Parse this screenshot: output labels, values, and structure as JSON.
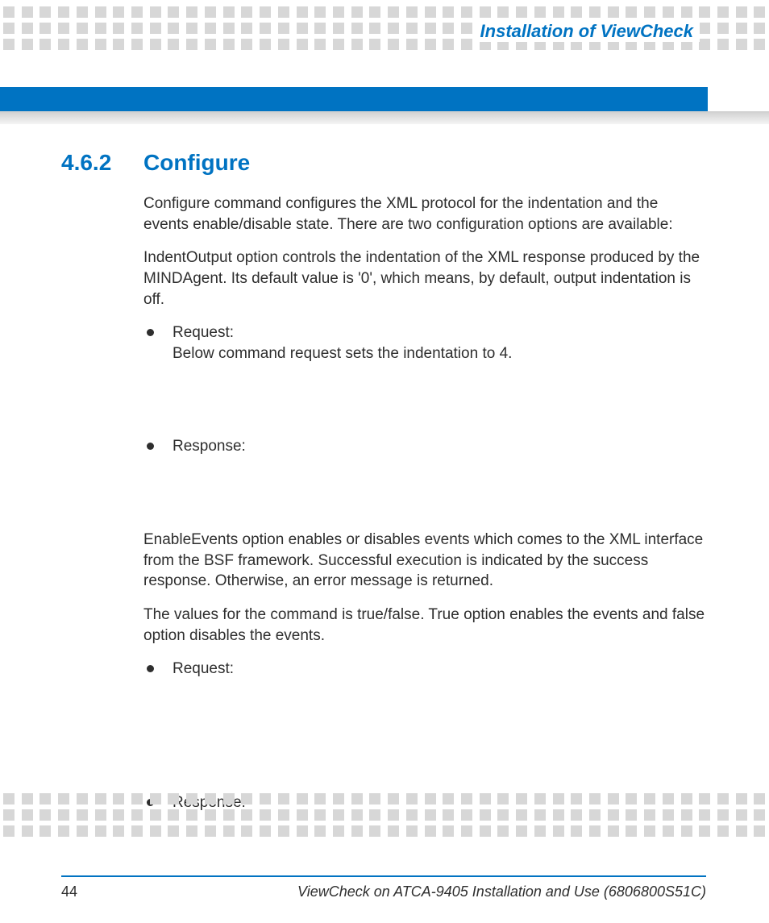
{
  "header": {
    "chapter_title": "Installation of ViewCheck"
  },
  "section": {
    "number": "4.6.2",
    "title": "Configure",
    "para1": "Configure command configures the XML protocol for the indentation and the events enable/disable state. There are two configuration options are available:",
    "para2": "IndentOutput option controls the indentation of the XML response produced by the MINDAgent. Its default value is '0', which means, by default, output indentation is off.",
    "bullets1": {
      "item1_label": "Request:",
      "item1_text": "Below command request sets the indentation to 4.",
      "item2_label": "Response:"
    },
    "para3": "EnableEvents option enables or disables events which comes to the XML interface from the BSF framework. Successful execution is indicated by the success response. Otherwise, an error message is returned.",
    "para4": "The values for the command is true/false. True option enables the events and false option disables the events.",
    "bullets2": {
      "item1_label": "Request:",
      "item2_label": "Response:"
    }
  },
  "footer": {
    "page_number": "44",
    "doc_title": "ViewCheck on ATCA-9405 Installation and Use (6806800S51C)"
  }
}
